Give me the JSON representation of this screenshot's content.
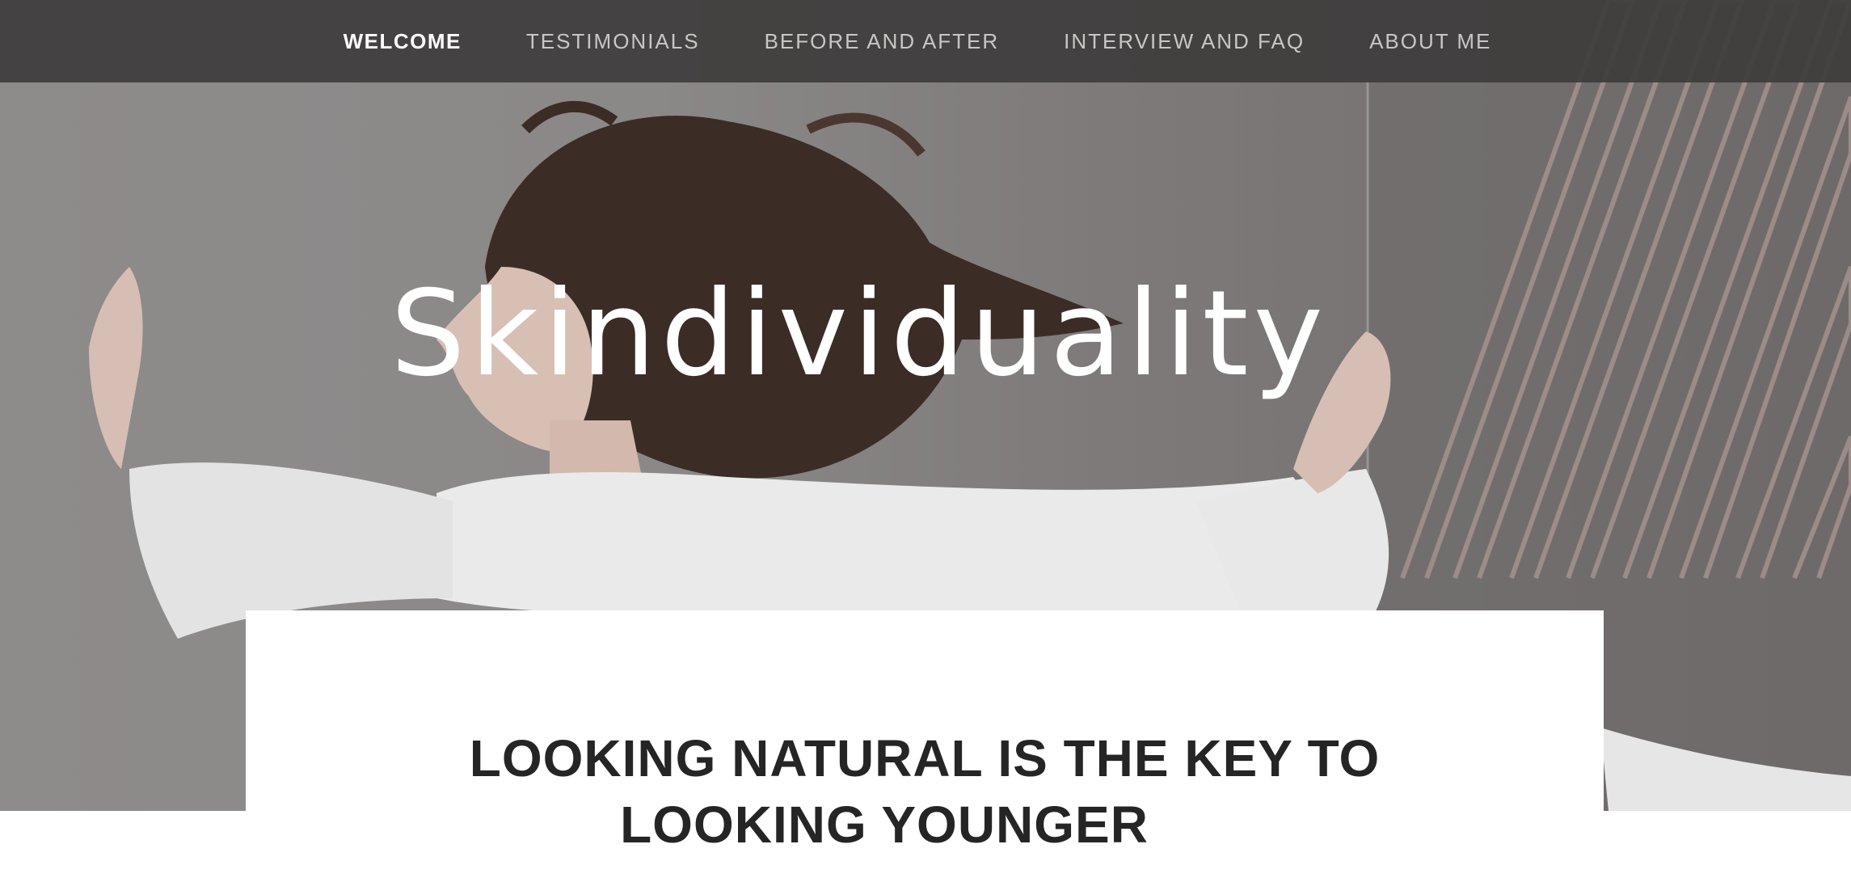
{
  "nav": {
    "items": [
      {
        "label": "WELCOME",
        "active": true
      },
      {
        "label": "TESTIMONIALS",
        "active": false
      },
      {
        "label": "BEFORE AND AFTER",
        "active": false
      },
      {
        "label": "INTERVIEW AND FAQ",
        "active": false
      },
      {
        "label": "ABOUT ME",
        "active": false
      }
    ]
  },
  "hero": {
    "title": "Skindividuality",
    "image_subject": "woman-dancing-hero-photo"
  },
  "content": {
    "heading_line1": "LOOKING NATURAL IS THE KEY TO",
    "heading_line2": "LOOKING YOUNGER"
  },
  "colors": {
    "nav_bg": "#3e3c3c",
    "nav_text": "#c9c6c6",
    "nav_active": "#ffffff",
    "heading_text": "#252525",
    "card_bg": "#ffffff"
  }
}
